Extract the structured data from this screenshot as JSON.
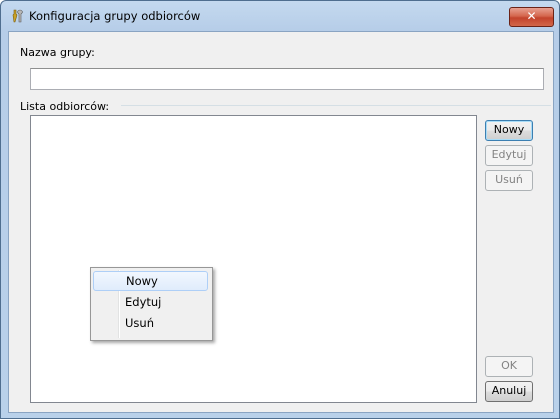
{
  "window": {
    "title": "Konfiguracja grupy odbiorców",
    "close_label": "✕"
  },
  "form": {
    "group_name_label": "Nazwa grupy:",
    "group_name_value": "",
    "recipients_label": "Lista odbiorców:"
  },
  "buttons": {
    "new": "Nowy",
    "edit": "Edytuj",
    "delete": "Usuń",
    "ok": "OK",
    "cancel": "Anuluj"
  },
  "context_menu": {
    "items": [
      {
        "label": "Nowy",
        "highlighted": true
      },
      {
        "label": "Edytuj",
        "highlighted": false
      },
      {
        "label": "Usuń",
        "highlighted": false
      }
    ]
  },
  "colors": {
    "title_bar": "#b9d1ea",
    "close_button": "#c3432c",
    "dialog_background": "#f0f0f0",
    "menu_highlight_border": "#aecff7"
  }
}
